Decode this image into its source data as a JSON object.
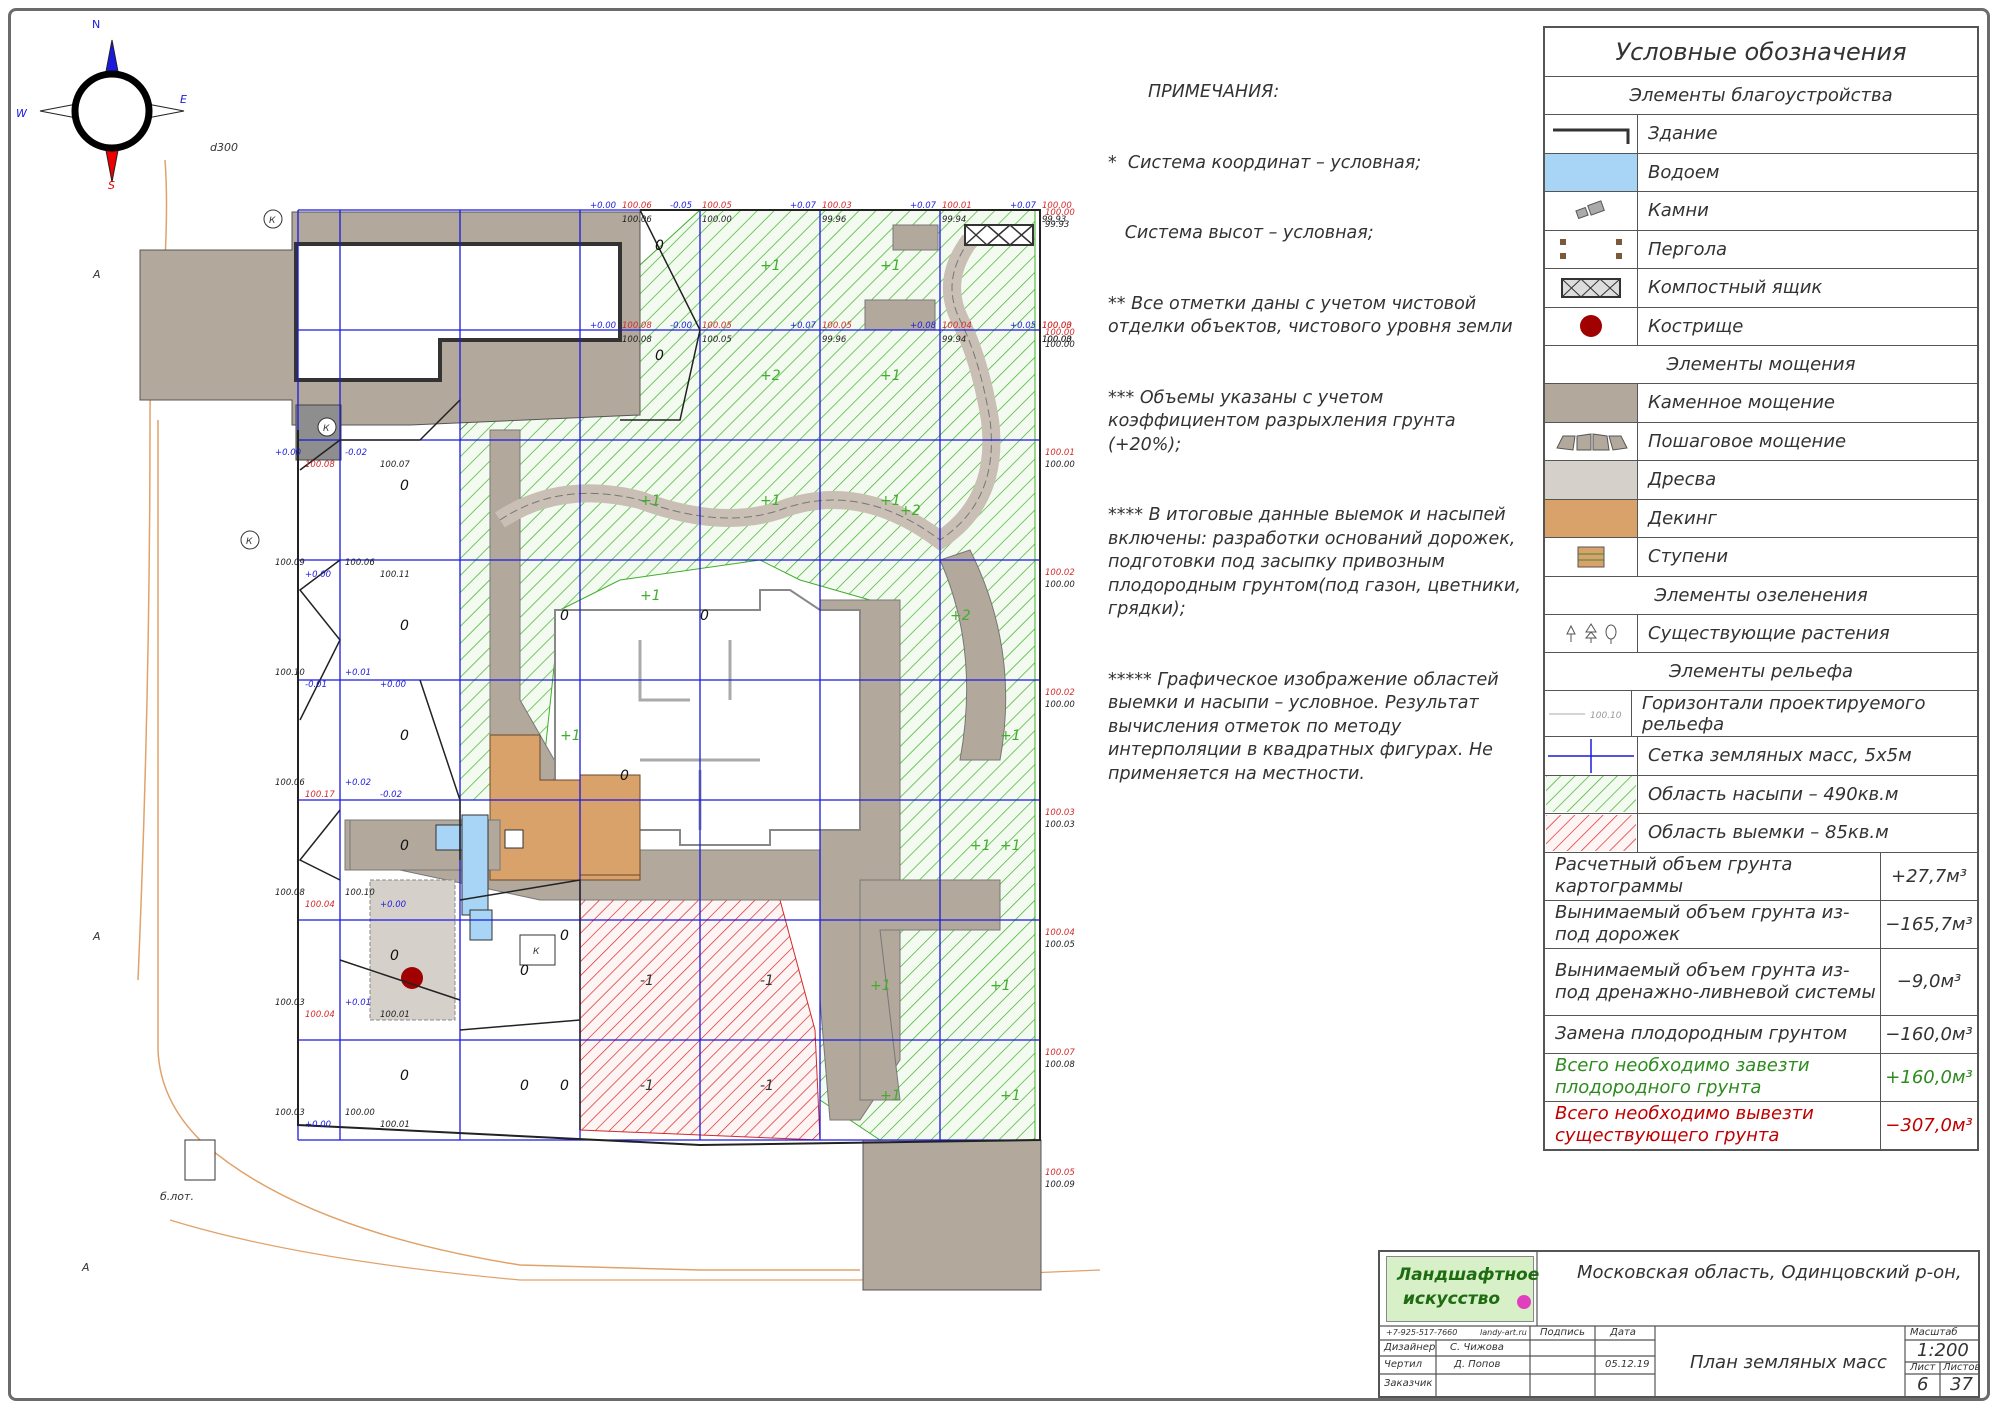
{
  "compass": {
    "n": "N",
    "e": "E",
    "w": "W",
    "s": "S"
  },
  "site_labels": {
    "pipe": "d300",
    "a1": "A",
    "a2": "A",
    "a3": "A",
    "pole": "б.лот."
  },
  "k_labels": [
    "К",
    "К",
    "К",
    "К"
  ],
  "grid": {
    "rows": [
      {
        "cells": [
          {
            "d": "+0.00",
            "r": "100.06",
            "b": "100.06"
          },
          {
            "d": "-0.05",
            "r": "100.05",
            "b": "100.00"
          },
          {
            "d": "+0.07",
            "r": "100.03",
            "b": "99.96"
          },
          {
            "d": "+0.07",
            "r": "100.01",
            "b": "99.94"
          },
          {
            "d": "+0.07",
            "r": "100.00",
            "b": "99.93"
          }
        ]
      },
      {
        "cells": [
          {
            "d": "+0.00",
            "r": "100.08",
            "b": "100.08"
          },
          {
            "d": "-0.00",
            "r": "100.05",
            "b": "100.05"
          },
          {
            "d": "+0.07",
            "r": "100.05",
            "b": "99.96"
          },
          {
            "d": "+0.08",
            "r": "100.04",
            "b": "99.94"
          },
          {
            "d": "+0.05",
            "r": "100.03",
            "b": "100.03"
          },
          {
            "d": "",
            "r": "100.00",
            "b": "100.00"
          }
        ]
      }
    ],
    "side_values": [
      "+0.00",
      "100.08",
      "-0.02",
      "100.07",
      "100.09",
      "+0.00",
      "100.06",
      "100.11",
      "100.10",
      "-0.01",
      "+0.01",
      "+0.00",
      "100.06",
      "100.17",
      "+0.02",
      "-0.02",
      "100.08",
      "100.04",
      "100.10",
      "+0.00",
      "100.03",
      "100.04",
      "+0.01",
      "100.01",
      "100.03",
      "+0.00",
      "100.00",
      "100.01"
    ],
    "right_values": [
      "100.00",
      "99.93",
      "100.00",
      "100.00",
      "100.01",
      "100.00",
      "100.02",
      "100.00",
      "100.02",
      "100.00",
      "100.03",
      "100.03",
      "100.04",
      "100.05",
      "100.07",
      "100.08",
      "100.05",
      "100.09"
    ],
    "cell_marks": [
      "0",
      "0",
      "0",
      "0",
      "0",
      "0",
      "0",
      "0",
      "0",
      "0",
      "0",
      "0",
      "0",
      "0",
      "0",
      "+1",
      "+1",
      "+2",
      "+1",
      "+1",
      "+1",
      "+1",
      "+2",
      "+1",
      "+1",
      "+2",
      "+1",
      "+1",
      "+1",
      "+1",
      "+1",
      "+1",
      "+1",
      "-1",
      "-1",
      "-1",
      "-1"
    ]
  },
  "notes": {
    "title": "ПРИМЕЧАНИЯ:",
    "lines": [
      "*  Система координат – условная;",
      "   Система высот – условная;",
      "** Все отметки даны с учетом чистовой отделки объектов, чистового уровня земли",
      "*** Объемы указаны с учетом коэффициентом разрыхления грунта (+20%);",
      "**** В итоговые данные выемок и насыпей включены: разработки оснований дорожек, подготовки под засыпку привозным плодородным грунтом(под газон, цветники, грядки);",
      "***** Графическое изображение областей выемки и насыпи – условное. Результат вычисления отметок по методу интерполяции в квадратных фигурах. Не применяется на местности."
    ]
  },
  "legend": {
    "title": "Условные обозначения",
    "section_landscaping": "Элементы благоустройства",
    "building": "Здание",
    "pond": "Водоем",
    "stones": "Камни",
    "pergola": "Пергола",
    "compost": "Компостный ящик",
    "fire": "Кострище",
    "section_paving": "Элементы мощения",
    "stone_paving": "Каменное мощение",
    "step_paving": "Пошаговое мощение",
    "wood_chips": "Дресва",
    "decking": "Декинг",
    "steps": "Ступени",
    "section_green": "Элементы озеленения",
    "plants": "Существующие растения",
    "section_relief": "Элементы рельефа",
    "contour": "Горизонтали проектируемого рельефа",
    "contour_sample": "100.10",
    "grid": "Сетка земляных масс, 5х5м",
    "fill": "Область насыпи – 490кв.м",
    "cut": "Область выемки – 85кв.м",
    "colors": {
      "building": "#7a6e64",
      "pond": "#a8d4f5",
      "stone": "#b3a89c",
      "chips": "#d6d0cb",
      "decking": "#d9a26a",
      "fill": "#3fae2a",
      "cut": "#d22a2a",
      "fire": "#a00000",
      "grid": "#1a1adf"
    }
  },
  "volumes": [
    {
      "label": "Расчетный объем грунта картограммы",
      "value": "+27,7м³",
      "type": "normal"
    },
    {
      "label": "Вынимаемый объем грунта из-под дорожек",
      "value": "−165,7м³",
      "type": "normal"
    },
    {
      "label": "Вынимаемый объем грунта из-под дренажно-ливневой системы",
      "value": "−9,0м³",
      "type": "tall"
    },
    {
      "label": "Замена плодородным грунтом",
      "value": "−160,0м³",
      "type": "short"
    },
    {
      "label": "Всего необходимо завезти плодородного грунта",
      "value": "+160,0м³",
      "type": "green"
    },
    {
      "label": "Всего необходимо вывезти существующего грунта",
      "value": "−307,0м³",
      "type": "red"
    }
  ],
  "stamp": {
    "logo_line1": "Ландшафтное",
    "logo_line2": "искусство",
    "phone": "+7-925-517-7660",
    "site": "landy-art.ru",
    "address": "Московская область, Одинцовский р-он,",
    "col_sign": "Подпись",
    "col_date": "Дата",
    "designer_role": "Дизайнер",
    "designer_name": "С. Чижова",
    "drafter_role": "Чертил",
    "drafter_name": "Д. Попов",
    "date": "05.12.19",
    "client_role": "Заказчик",
    "sheet_title": "План земляных масс",
    "scale_label": "Масштаб",
    "scale": "1:200",
    "sheet_label": "Лист",
    "sheets_label": "Листов",
    "sheet": "6",
    "sheets": "37"
  }
}
